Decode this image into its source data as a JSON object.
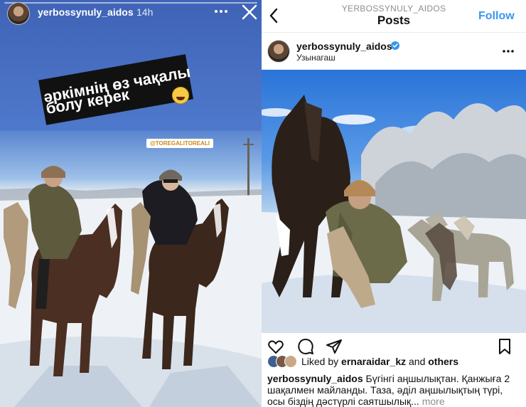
{
  "story": {
    "username": "yerbossynuly_aidos",
    "time": "14h",
    "caption_line1": "әркімнің өз чақалы",
    "caption_line2": "болу керек",
    "mention_tag": "@TOREGALITOREALI"
  },
  "post": {
    "header_username": "YERBOSSYNULY_AIDOS",
    "header_title": "Posts",
    "follow_label": "Follow",
    "author_name": "yerbossynuly_aidos",
    "author_location": "Узынагаш",
    "liked_by_prefix": "Liked by",
    "liked_by_user": "ernaraidar_kz",
    "liked_by_and": "and",
    "liked_by_others": "others",
    "caption_user": "yerbossynuly_aidos",
    "caption_text": "Бүгінгі аңшылықтан. Қанжыға 2 шақалмен майланды. Таза, әділ аңшылықтың түрі, осы біздің дәстүрлі саятшылық...",
    "caption_more": "more"
  },
  "colors": {
    "accent_blue": "#3897f0",
    "story_bg": "#3f63b6",
    "verified": "#3897f0"
  },
  "icons": {
    "story_more": "more-horizontal-icon",
    "story_close": "close-icon",
    "back": "chevron-left-icon",
    "verified": "verified-badge-icon",
    "post_more": "more-horizontal-icon",
    "like": "heart-icon",
    "comment": "comment-icon",
    "share": "send-icon",
    "save": "bookmark-icon"
  }
}
